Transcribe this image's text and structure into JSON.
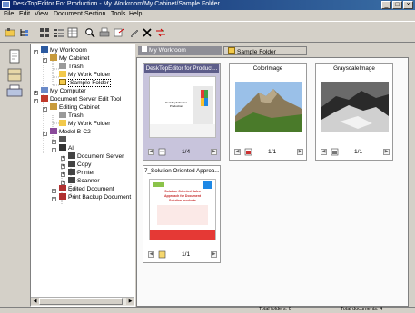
{
  "window": {
    "title": "DeskTopEditor For Production - My Workroom/My Cabinet/Sample Folder",
    "buttons": [
      "_",
      "□",
      "×"
    ]
  },
  "menu": [
    "File",
    "Edit",
    "View",
    "Document",
    "Section",
    "Tools",
    "Help"
  ],
  "toolbar": {
    "icons": [
      "open-folder-icon",
      "tree-view-icon",
      "large-icons-icon",
      "list-view-icon",
      "details-view-icon",
      "search-icon",
      "print-icon",
      "send-icon",
      "pen-icon",
      "delete-icon",
      "move-icon"
    ]
  },
  "left_strip_icons": [
    "new-document-icon",
    "cabinet-icon",
    "server-icon"
  ],
  "tree": {
    "nodes": [
      {
        "label": "My Workroom",
        "icon": "workroom-icon",
        "level": 0,
        "expander": "-"
      },
      {
        "label": "My Cabinet",
        "icon": "cabinet-icon",
        "level": 1,
        "expander": "-"
      },
      {
        "label": "Trash",
        "icon": "trash-icon",
        "level": 2,
        "expander": ""
      },
      {
        "label": "My Work Folder",
        "icon": "folder-icon",
        "level": 2,
        "expander": ""
      },
      {
        "label": "Sample Folder",
        "icon": "folder-open-icon",
        "level": 2,
        "expander": "",
        "selected": true
      },
      {
        "label": "My Computer",
        "icon": "computer-icon",
        "level": 0,
        "expander": "+"
      },
      {
        "label": "Document Server Edit Tool",
        "icon": "server-icon",
        "level": 0,
        "expander": "-"
      },
      {
        "label": "Editing Cabinet",
        "icon": "cabinet-icon",
        "level": 1,
        "expander": "-"
      },
      {
        "label": "Trash",
        "icon": "trash-icon",
        "level": 2,
        "expander": ""
      },
      {
        "label": "My Work Folder",
        "icon": "folder-icon",
        "level": 2,
        "expander": ""
      },
      {
        "label": "Model B-C2",
        "icon": "printer-model-icon",
        "level": 1,
        "expander": "-"
      },
      {
        "label": "",
        "icon": "group-icon",
        "level": 2,
        "expander": "+"
      },
      {
        "label": "All",
        "icon": "all-icon",
        "level": 2,
        "expander": "-"
      },
      {
        "label": "Document Server",
        "icon": "docserver-icon",
        "level": 3,
        "expander": "+"
      },
      {
        "label": "Copy",
        "icon": "copy-icon",
        "level": 3,
        "expander": "+"
      },
      {
        "label": "Printer",
        "icon": "printer-icon",
        "level": 3,
        "expander": "+"
      },
      {
        "label": "Scanner",
        "icon": "scanner-icon",
        "level": 3,
        "expander": "+"
      },
      {
        "label": "Edited Document",
        "icon": "edited-doc-icon",
        "level": 2,
        "expander": "+"
      },
      {
        "label": "Print Backup Document",
        "icon": "backup-doc-icon",
        "level": 2,
        "expander": "+"
      }
    ]
  },
  "tabs": [
    {
      "label": "My Workroom",
      "active": true
    },
    {
      "label": "Sample Folder",
      "active": false
    }
  ],
  "documents": [
    {
      "title": "DeskTopEditor for Product...",
      "page": "1/4",
      "thumb": "doc",
      "thumb_heading": "DeskTopEditor for Production",
      "selected": true
    },
    {
      "title": "ColorImage",
      "page": "1/1",
      "thumb": "color"
    },
    {
      "title": "GrayscaleImage",
      "page": "1/1",
      "thumb": "gray"
    },
    {
      "title": "7_Solution Oriented Approa...",
      "page": "1/1",
      "thumb": "solution",
      "thumb_heading": "Solution Oriented Sales Approach for Document Solution products"
    }
  ],
  "status": {
    "folders": "Total folders: 0",
    "documents": "Total documents: 4"
  },
  "colors": {
    "title_bar": "#0a246a",
    "selected_card": "#c8c4dc",
    "active_tab": "#8e8e96"
  }
}
